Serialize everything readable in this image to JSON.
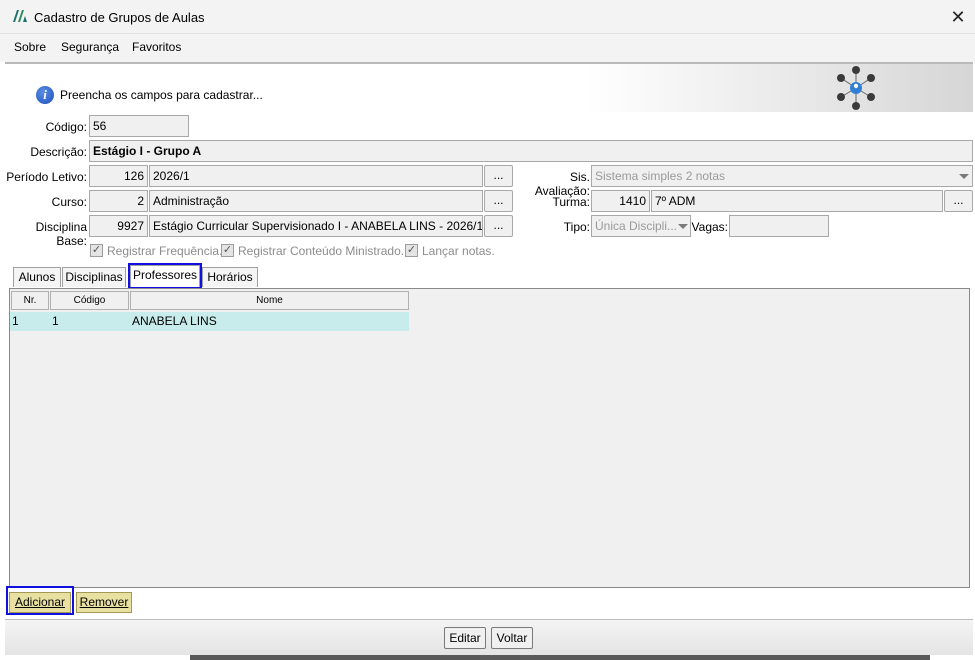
{
  "window": {
    "title": "Cadastro de Grupos de Aulas",
    "close_label": "✕"
  },
  "menu": {
    "items": [
      "Sobre",
      "Segurança",
      "Favoritos"
    ]
  },
  "info": {
    "message": "Preencha os campos para cadastrar..."
  },
  "form": {
    "codigo": {
      "label": "Código:",
      "value": "56"
    },
    "descricao": {
      "label": "Descrição:",
      "value": "Estágio I - Grupo A"
    },
    "periodo": {
      "label": "Período Letivo:",
      "code": "126",
      "name": "2026/1",
      "btn": "..."
    },
    "curso": {
      "label": "Curso:",
      "code": "2",
      "name": "Administração",
      "btn": "..."
    },
    "disciplina_base": {
      "label": "Disciplina Base:",
      "code": "9927",
      "name": "Estágio Curricular Supervisionado I - ANABELA LINS - 2026/1 -",
      "btn": "..."
    },
    "sis_avaliacao": {
      "label": "Sis. Avaliação:",
      "value": "Sistema simples 2 notas"
    },
    "turma": {
      "label": "Turma:",
      "code": "1410",
      "name": "7º ADM",
      "btn": "..."
    },
    "tipo": {
      "label": "Tipo:",
      "value": "Única Discipli..."
    },
    "vagas": {
      "label": "Vagas:",
      "value": ""
    },
    "checkboxes": [
      {
        "label": "Registrar Frequência.",
        "checked": true
      },
      {
        "label": "Registrar Conteúdo Ministrado.",
        "checked": true
      },
      {
        "label": "Lançar notas.",
        "checked": true
      }
    ]
  },
  "tabs": [
    "Alunos",
    "Disciplinas",
    "Professores",
    "Horários"
  ],
  "active_tab": "Professores",
  "grid": {
    "columns": [
      "Nr.",
      "Código",
      "Nome"
    ],
    "rows": [
      [
        "1",
        "1",
        "ANABELA LINS"
      ]
    ]
  },
  "grid_buttons": {
    "add": "Adicionar",
    "remove": "Remover"
  },
  "footer": {
    "edit": "Editar",
    "back": "Voltar"
  },
  "colors": {
    "highlight": "#1010e0",
    "selected_row": "#c8ecec",
    "grid_button": "#e8e0a0"
  }
}
